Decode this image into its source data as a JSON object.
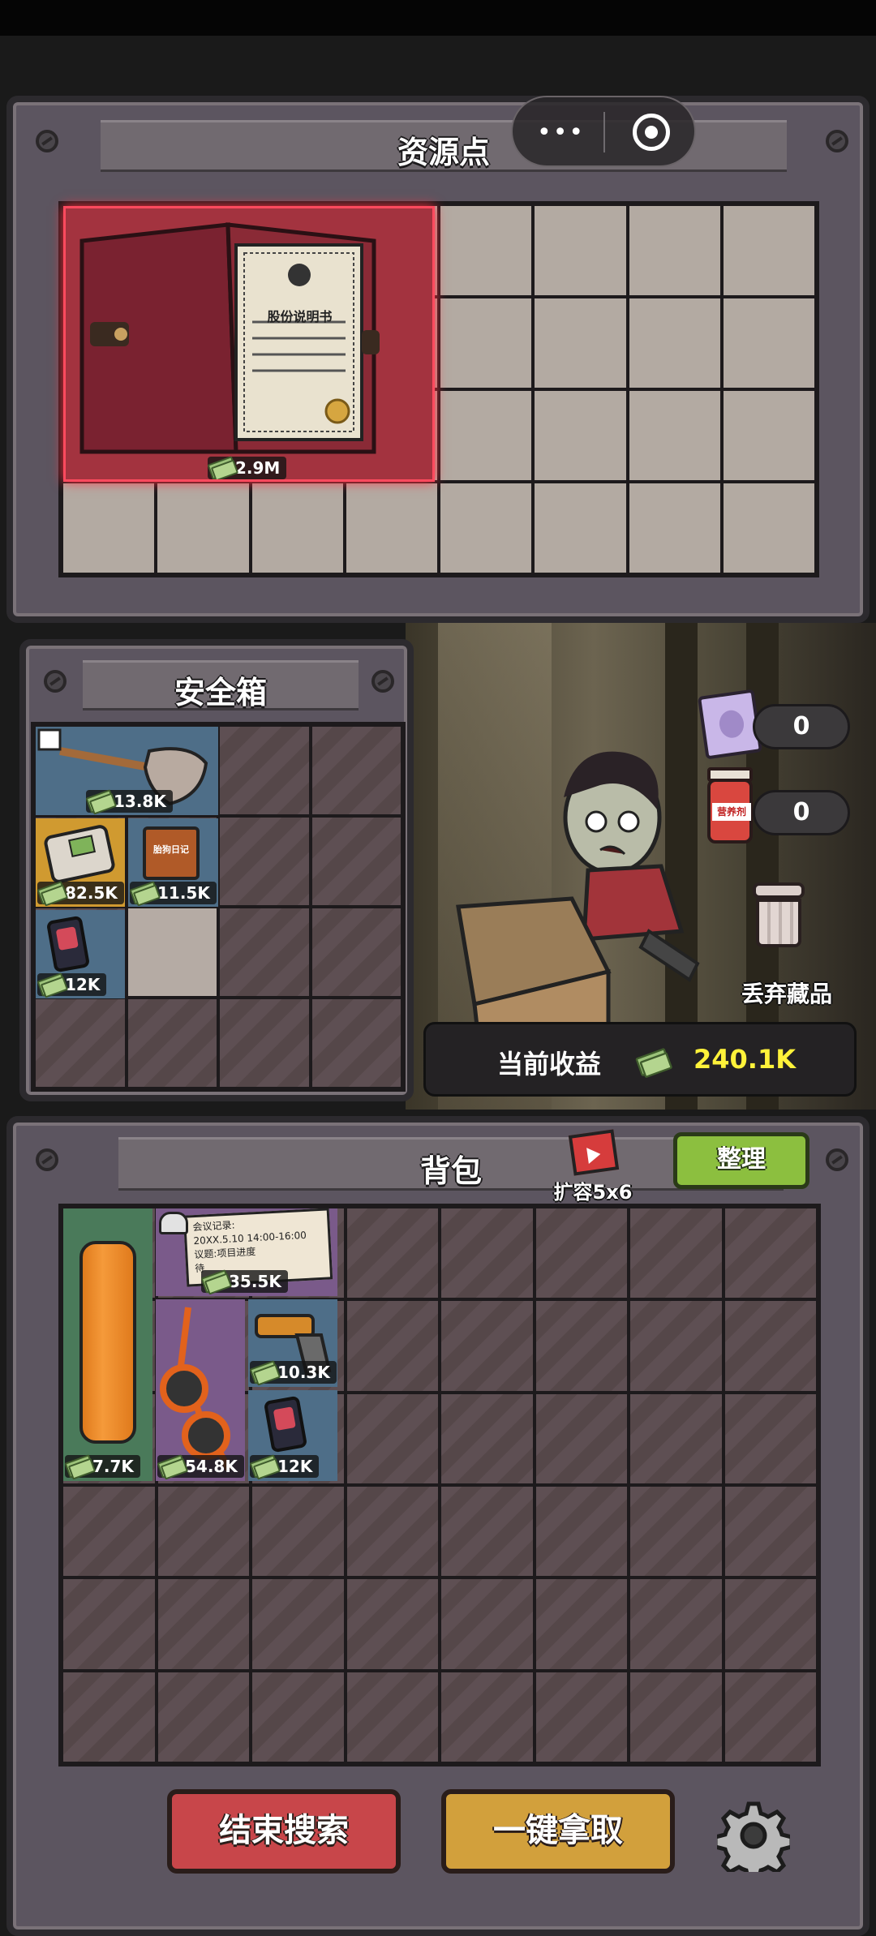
{
  "resource_panel": {
    "title": "资源点",
    "item": {
      "name_on_card": "股份说明书",
      "value": "2.9M"
    }
  },
  "capsule": {
    "more_icon": "more-dots-icon",
    "close_icon": "target-icon"
  },
  "safe_box": {
    "title": "安全箱",
    "items": [
      {
        "name": "shovel",
        "value": "13.8K"
      },
      {
        "name": "handheld-console",
        "value": "82.5K"
      },
      {
        "name": "diary",
        "value": "11.5K",
        "card_text": "胎狗日记"
      },
      {
        "name": "photo-badge",
        "value": "12K"
      }
    ]
  },
  "side": {
    "book_count": "0",
    "bottle_count": "0",
    "bottle_label": "营养剂",
    "discard_label": "丢弃藏品",
    "income_label": "当前收益",
    "income_value": "240.1K"
  },
  "backpack": {
    "title": "背包",
    "expand_label": "扩容5x6",
    "sort_label": "整理",
    "items": [
      {
        "name": "orange-cloth",
        "value": "7.7K"
      },
      {
        "name": "meeting-note",
        "value": "35.5K",
        "note_lines": [
          "会议记录:",
          "20XX.5.10 14:00-16:00",
          "议题:项目进度",
          "待"
        ]
      },
      {
        "name": "sunglasses",
        "value": "54.8K"
      },
      {
        "name": "flare-gun",
        "value": "10.3K"
      },
      {
        "name": "photo-badge",
        "value": "12K"
      }
    ]
  },
  "actions": {
    "end_search": "结束搜索",
    "take_all": "一键拿取"
  },
  "colors": {
    "panel": "#5c5560",
    "red_button": "#c8464a",
    "yellow_button": "#d2a03c",
    "green_button": "#8cbf3f",
    "income": "#fff23a"
  }
}
